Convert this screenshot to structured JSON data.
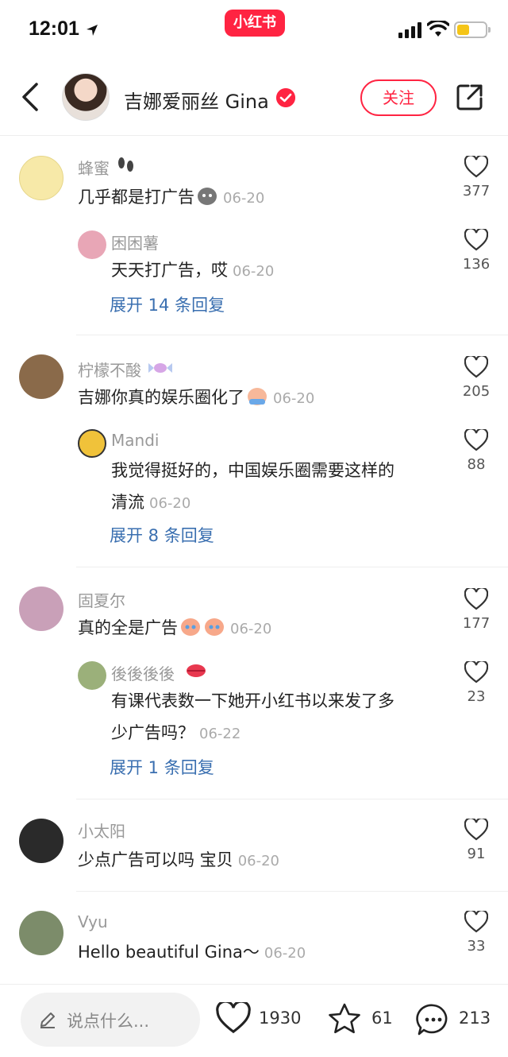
{
  "status": {
    "time": "12:01",
    "app_badge": "小红书",
    "battery_level": 0.45
  },
  "header": {
    "author_name": "吉娜爱丽丝 Gina",
    "follow_label": "关注"
  },
  "comments": [
    {
      "name": "蜂蜜",
      "text": "几乎都是打广告",
      "date": "06-20",
      "likes": "377",
      "reply": {
        "name": "困困薯",
        "text": "天天打广告，哎",
        "date": "06-20",
        "likes": "136"
      },
      "expand": "展开 14 条回复"
    },
    {
      "name": "柠檬不酸",
      "text": "吉娜你真的娱乐圈化了",
      "date": "06-20",
      "likes": "205",
      "reply": {
        "name": "Mandi",
        "text": "我觉得挺好的，中国娱乐圈需要这样的",
        "text2": "清流",
        "date": "06-20",
        "likes": "88"
      },
      "expand": "展开 8 条回复"
    },
    {
      "name": "固夏尔",
      "text": "真的全是广告",
      "date": "06-20",
      "likes": "177",
      "reply": {
        "name": "後後後後",
        "text": "有课代表数一下她开小红书以来发了多",
        "text2": "少广告吗？",
        "date": "06-22",
        "likes": "23"
      },
      "expand": "展开 1 条回复"
    },
    {
      "name": "小太阳",
      "text": "少点广告可以吗 宝贝",
      "date": "06-20",
      "likes": "91"
    },
    {
      "name": "Vyu",
      "text": "Hello beautiful Gina～",
      "date": "06-20",
      "likes": "33"
    }
  ],
  "bottom": {
    "placeholder": "说点什么...",
    "likes": "1930",
    "stars": "61",
    "comments": "213"
  },
  "colors": {
    "brand": "#ff2442",
    "link": "#3a6fb0"
  }
}
